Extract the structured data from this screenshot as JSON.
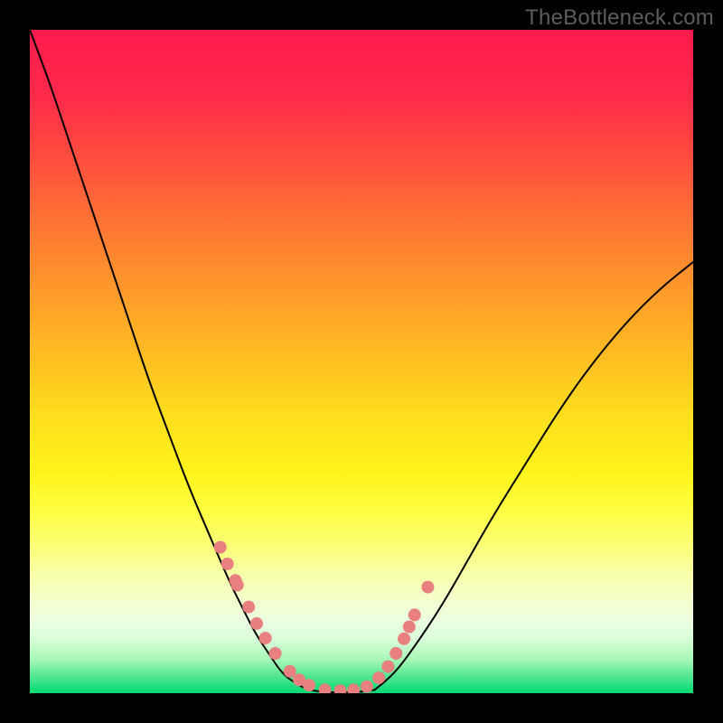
{
  "watermark": "TheBottleneck.com",
  "chart_data": {
    "type": "line",
    "title": "",
    "xlabel": "",
    "ylabel": "",
    "xlim": [
      0,
      100
    ],
    "ylim": [
      0,
      100
    ],
    "grid": false,
    "legend": false,
    "series": [
      {
        "name": "curve-left",
        "x": [
          0,
          3,
          6,
          9,
          12,
          15,
          18,
          21,
          24,
          27,
          30,
          32,
          34,
          36,
          38,
          40,
          42
        ],
        "y": [
          100,
          92,
          83,
          74,
          65,
          56,
          47,
          39,
          31,
          24,
          17,
          13,
          9,
          6,
          3,
          1.5,
          0.5
        ]
      },
      {
        "name": "flat-bottom",
        "x": [
          42,
          44,
          46,
          48,
          50,
          52
        ],
        "y": [
          0.5,
          0.2,
          0.1,
          0.1,
          0.2,
          0.5
        ]
      },
      {
        "name": "curve-right",
        "x": [
          52,
          55,
          58,
          62,
          66,
          70,
          75,
          80,
          85,
          90,
          95,
          100
        ],
        "y": [
          0.5,
          3,
          7,
          13,
          20,
          27,
          35,
          43,
          50,
          56,
          61,
          65
        ]
      }
    ],
    "markers": {
      "name": "dots",
      "x": [
        28.7,
        29.8,
        31.0,
        31.3,
        33.0,
        34.2,
        35.5,
        37.0,
        39.2,
        40.6,
        42.1,
        44.5,
        46.8,
        48.8,
        50.8,
        52.6,
        54.0,
        55.2,
        56.4,
        57.2,
        58.0,
        60.0
      ],
      "y": [
        22.0,
        19.5,
        17.0,
        16.3,
        13.0,
        10.5,
        8.3,
        6.0,
        3.3,
        2.0,
        1.2,
        0.5,
        0.4,
        0.5,
        1.0,
        2.3,
        4.0,
        6.0,
        8.2,
        10.0,
        11.8,
        16.0
      ],
      "color": "#e98080",
      "radius": 7
    }
  }
}
